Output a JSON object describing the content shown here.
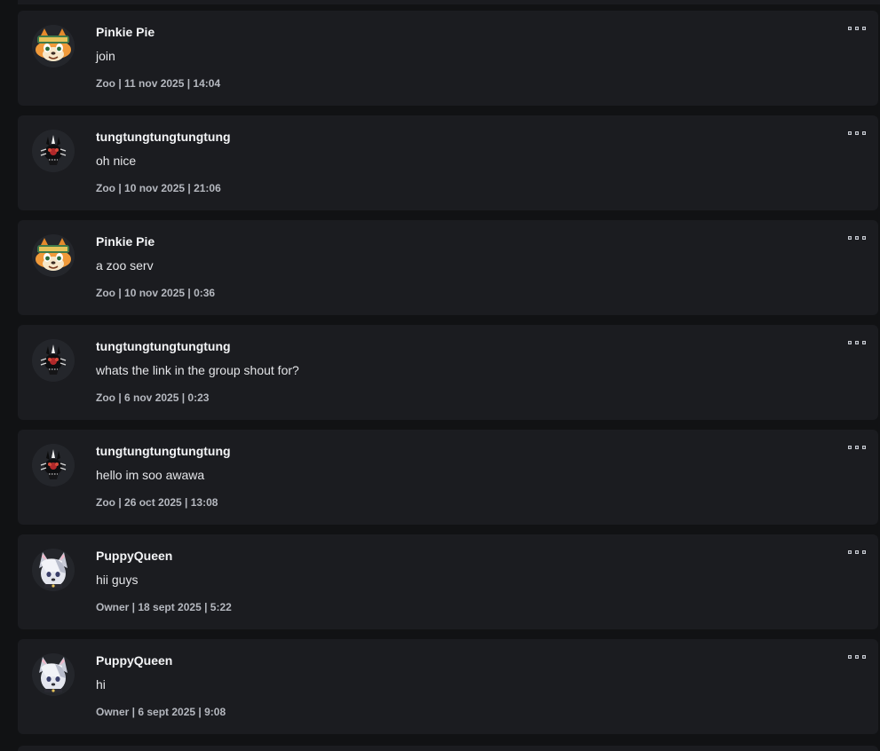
{
  "posts": [
    {
      "author": "Pinkie Pie",
      "avatar": "fox-avatar-icon",
      "text": "join",
      "meta": "Zoo | 11 nov 2025 | 14:04"
    },
    {
      "author": "tungtungtungtungtung",
      "avatar": "dark-creature-avatar-icon",
      "text": "oh nice",
      "meta": "Zoo | 10 nov 2025 | 21:06"
    },
    {
      "author": "Pinkie Pie",
      "avatar": "fox-avatar-icon",
      "text": "a zoo serv",
      "meta": "Zoo | 10 nov 2025 | 0:36"
    },
    {
      "author": "tungtungtungtungtung",
      "avatar": "dark-creature-avatar-icon",
      "text": "whats the link in the group shout for?",
      "meta": "Zoo | 6 nov 2025 | 0:23"
    },
    {
      "author": "tungtungtungtungtung",
      "avatar": "dark-creature-avatar-icon",
      "text": "hello im soo awawa",
      "meta": "Zoo | 26 oct 2025 | 13:08"
    },
    {
      "author": "PuppyQueen",
      "avatar": "wolf-avatar-icon",
      "text": "hii guys",
      "meta": "Owner | 18 sept 2025 | 5:22"
    },
    {
      "author": "PuppyQueen",
      "avatar": "wolf-avatar-icon",
      "text": "hi",
      "meta": "Owner | 6 sept 2025 | 9:08"
    }
  ],
  "colors": {
    "background": "#111214",
    "card": "#1b1c20",
    "author": "#f3f4f6",
    "body": "#e4e5e8",
    "meta": "#b5b8bf"
  },
  "icons": {
    "more": "more-options-icon"
  }
}
